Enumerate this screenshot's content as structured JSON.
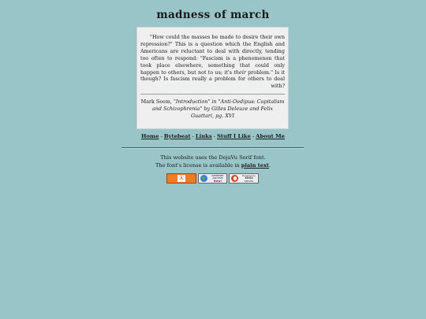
{
  "site": {
    "title": "madness of march"
  },
  "quote": {
    "part1": "\"How could the masses be made to desire their own repression?\" This is a question which the English and Americans are reluctant to deal with directly, tending too often to respond: \"Fascism is a phenomenon that took place elsewhere, something that could only happen to others, but not to us; it's ",
    "emphasis": "their",
    "part2": " problem.\" Is it though? Is fascism really a problem for others to deal with?",
    "citation_author": "Mark Seem, ",
    "citation_work": "\"Introduction\" in \"Anti-Oedipus: Capitalism and Schizophrenia\" by Gilles Deleuze and Felix Guattari, pg. XVI"
  },
  "nav": {
    "items": [
      {
        "label": "Home"
      },
      {
        "label": "Bytebeat"
      },
      {
        "label": "Links"
      },
      {
        "label": "Stuff I Like"
      },
      {
        "label": "About Me"
      }
    ],
    "separator": "-"
  },
  "footer": {
    "font_line": "This website uses the DejaVu Serif font.",
    "license_prefix": "The font's license is available in ",
    "license_link": "plain text",
    "license_suffix": "."
  },
  "badges": {
    "internet_archive_line1": "INTERNET",
    "internet_archive_line2": "ARCHIVE",
    "internet_archive_line3": "Now!",
    "third_line1": "Powered by",
    "third_line2": "XXXX",
    "third_line3": "SERVER"
  },
  "colors": {
    "background": "#99c5c8",
    "quote_box": "#efefef",
    "badge_orange": "#f07b22"
  }
}
